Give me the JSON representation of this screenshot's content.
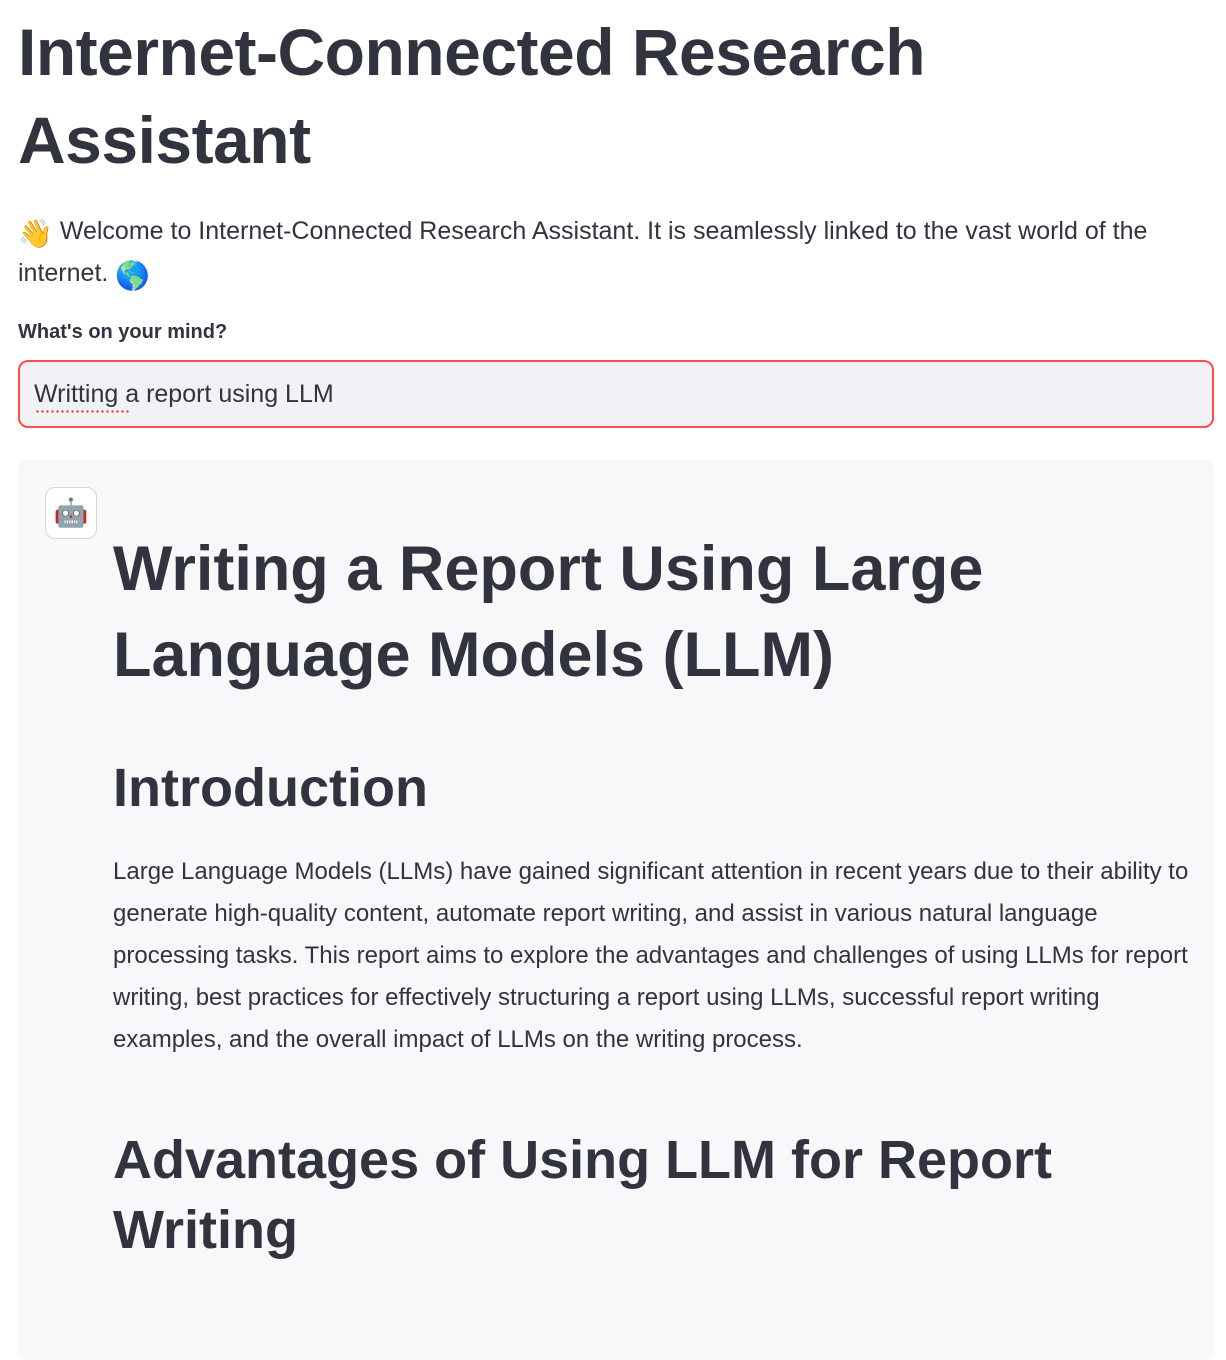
{
  "app": {
    "title": "Internet-Connected Research Assistant",
    "welcome_wave_emoji": "👋",
    "welcome_text": "Welcome to Internet-Connected Research Assistant. It is seamlessly linked to the vast world of the internet.",
    "welcome_globe_emoji": "🌎"
  },
  "prompt": {
    "label": "What's on your mind?",
    "value": "Writting a report using LLM"
  },
  "message": {
    "avatar_icon": "robot-icon",
    "avatar_emoji": "🤖",
    "title": "Writing a Report Using Large Language Models (LLM)",
    "sections": [
      {
        "heading": "Introduction",
        "body": "Large Language Models (LLMs) have gained significant attention in recent years due to their ability to generate high-quality content, automate report writing, and assist in various natural language processing tasks. This report aims to explore the advantages and challenges of using LLMs for report writing, best practices for effectively structuring a report using LLMs, successful report writing examples, and the overall impact of LLMs on the writing process."
      },
      {
        "heading": "Advantages of Using LLM for Report Writing"
      }
    ]
  },
  "colors": {
    "text": "#31333f",
    "input_border_focus": "#ff4b4b",
    "input_background": "#f0f2f6",
    "message_background": "#f8f8fa"
  }
}
